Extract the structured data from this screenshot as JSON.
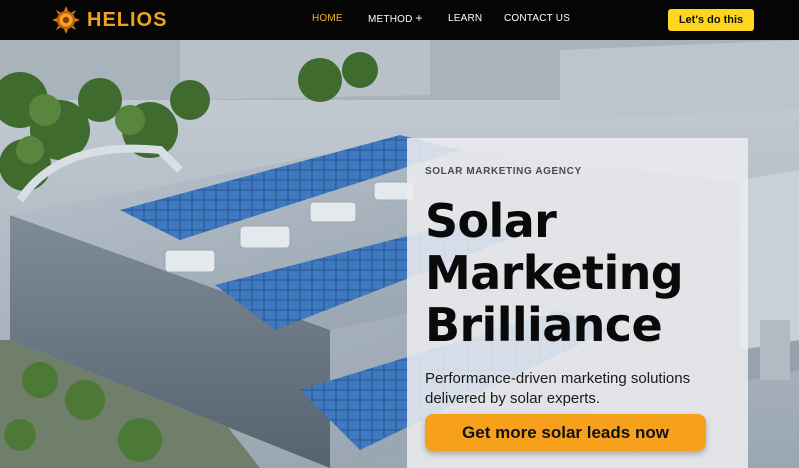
{
  "brand": {
    "name": "HELIOS",
    "logo_icon": "sun-gear-icon",
    "accent": "#f0a11d"
  },
  "nav": {
    "items": [
      {
        "label": "HOME",
        "active": true
      },
      {
        "label": "METHOD",
        "has_submenu": true
      },
      {
        "label": "LEARN"
      },
      {
        "label": "CONTACT US"
      }
    ],
    "submenu_icon": "+",
    "cta_label": "Let's do this",
    "cta_color": "#ffd61f"
  },
  "hero": {
    "eyebrow": "SOLAR MARKETING AGENCY",
    "headline": [
      "Solar",
      "Marketing",
      "Brilliance"
    ],
    "subtext": "Performance-driven marketing solutions delivered by solar experts.",
    "cta_label": "Get more solar leads now",
    "cta_color": "#f7a01c",
    "background_image": "aerial view of industrial building roof with solar panels"
  }
}
